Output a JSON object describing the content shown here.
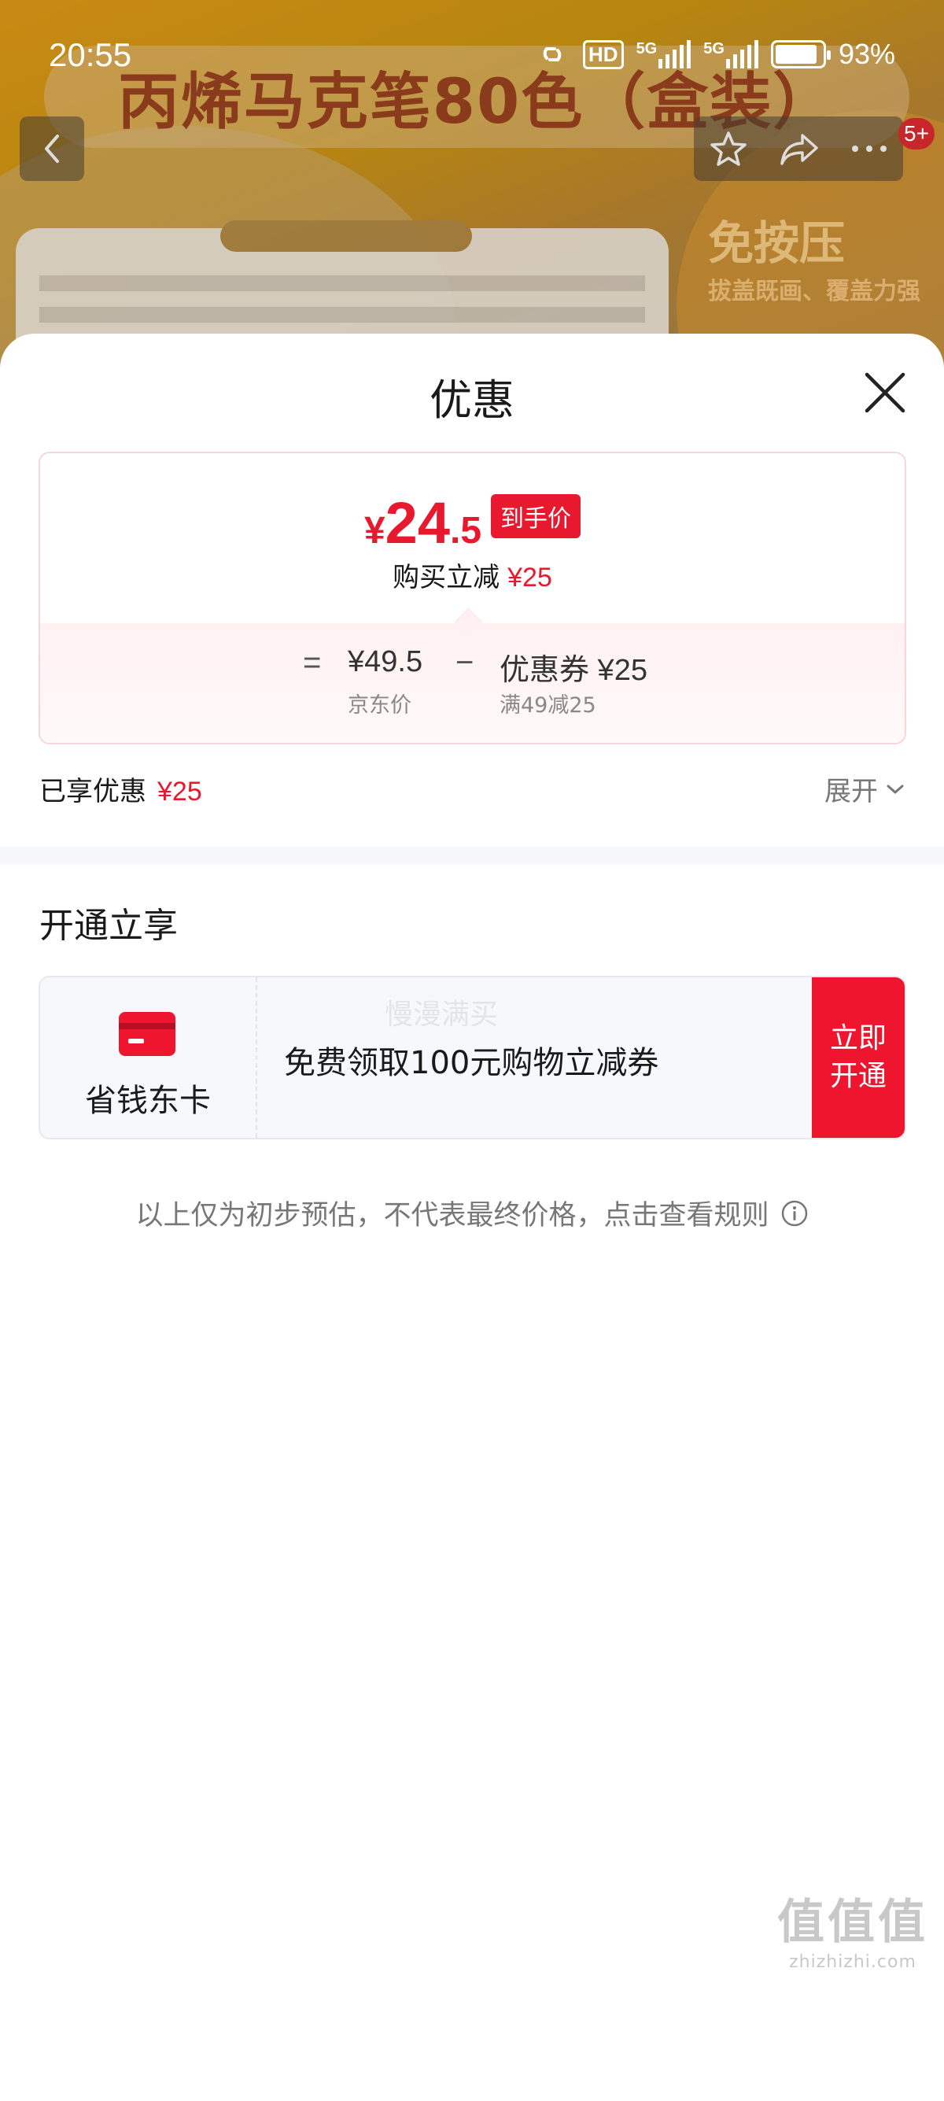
{
  "status_bar": {
    "time": "20:55",
    "hd_label": "HD",
    "net1": "5G",
    "net2": "5G",
    "battery": "93%"
  },
  "background": {
    "banner_title": "丙烯马克笔80色（盒装）",
    "promo_big": "免按压",
    "promo_small": "拔盖既画、覆盖力强",
    "cart_badge": "5+"
  },
  "sheet": {
    "title": "优惠",
    "price_card": {
      "yen": "¥",
      "price_int": "24",
      "price_dec": ".5",
      "final_tag": "到手价",
      "reduce_label": "购买立减",
      "reduce_amount": "¥25",
      "calc": {
        "equals": "=",
        "jd_price": "¥49.5",
        "jd_price_label": "京东价",
        "minus": "−",
        "coupon": "优惠券 ¥25",
        "coupon_rule": "满49减25"
      }
    },
    "enjoyed": {
      "label": "已享优惠",
      "amount": "¥25"
    },
    "expand_label": "展开",
    "open_section_title": "开通立享",
    "member": {
      "name": "省钱东卡",
      "watermark": "慢漫满买",
      "desc": "免费领取100元购物立减券",
      "button_line1": "立即",
      "button_line2": "开通"
    },
    "disclaimer": "以上仅为初步预估，不代表最终价格，点击查看规则"
  },
  "corner_logo": {
    "big": "值值值",
    "small": "zhizhizhi.com"
  },
  "colors": {
    "accent_red": "#e8182e",
    "button_red": "#f0152f",
    "gray_text": "#777777"
  }
}
